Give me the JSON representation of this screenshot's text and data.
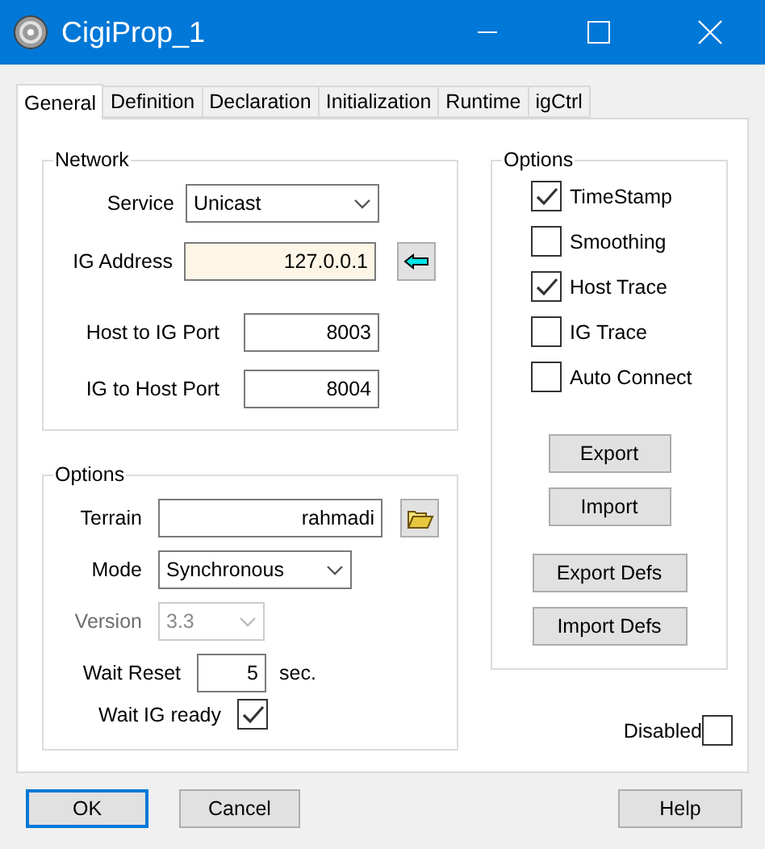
{
  "window": {
    "title": "CigiProp_1"
  },
  "tabs": [
    {
      "label": "General",
      "selected": true
    },
    {
      "label": "Definition",
      "selected": false
    },
    {
      "label": "Declaration",
      "selected": false
    },
    {
      "label": "Initialization",
      "selected": false
    },
    {
      "label": "Runtime",
      "selected": false
    },
    {
      "label": "igCtrl",
      "selected": false
    }
  ],
  "network": {
    "title": "Network",
    "fields": [
      {
        "kind": "select",
        "label": "Service",
        "value": "Unicast"
      },
      {
        "kind": "address",
        "label": "IG Address",
        "value": "127.0.0.1"
      },
      {
        "kind": "input",
        "label": "Host to IG Port",
        "value": "8003"
      },
      {
        "kind": "input",
        "label": "IG to Host Port",
        "value": "8004"
      }
    ]
  },
  "options": {
    "title": "Options",
    "fields": [
      {
        "kind": "file",
        "label": "Terrain",
        "value": "rahmadi"
      },
      {
        "kind": "select",
        "label": "Mode",
        "value": "Synchronous",
        "disabled": false
      },
      {
        "kind": "select",
        "label": "Version",
        "value": "3.3",
        "disabled": true
      },
      {
        "kind": "number",
        "label": "Wait Reset",
        "value": "5",
        "unit": "sec."
      },
      {
        "kind": "checkbox",
        "label": "Wait IG ready",
        "checked": true
      }
    ]
  },
  "flags": {
    "title": "Options",
    "items": [
      {
        "label": "TimeStamp",
        "checked": true
      },
      {
        "label": "Smoothing",
        "checked": false
      },
      {
        "label": "Host Trace",
        "checked": true
      },
      {
        "label": "IG Trace",
        "checked": false
      },
      {
        "label": "Auto Connect",
        "checked": false
      }
    ],
    "buttons": [
      {
        "label": "Export",
        "kind": "narrow"
      },
      {
        "label": "Import",
        "kind": "narrow"
      },
      {
        "label": "Export Defs",
        "kind": "wide"
      },
      {
        "label": "Import Defs",
        "kind": "wide"
      }
    ]
  },
  "disabled": {
    "label": "Disabled",
    "checked": false
  },
  "footer": [
    {
      "label": "OK",
      "kind": "default"
    },
    {
      "label": "Cancel",
      "kind": "normal"
    },
    {
      "label": "Help",
      "kind": "right"
    }
  ]
}
